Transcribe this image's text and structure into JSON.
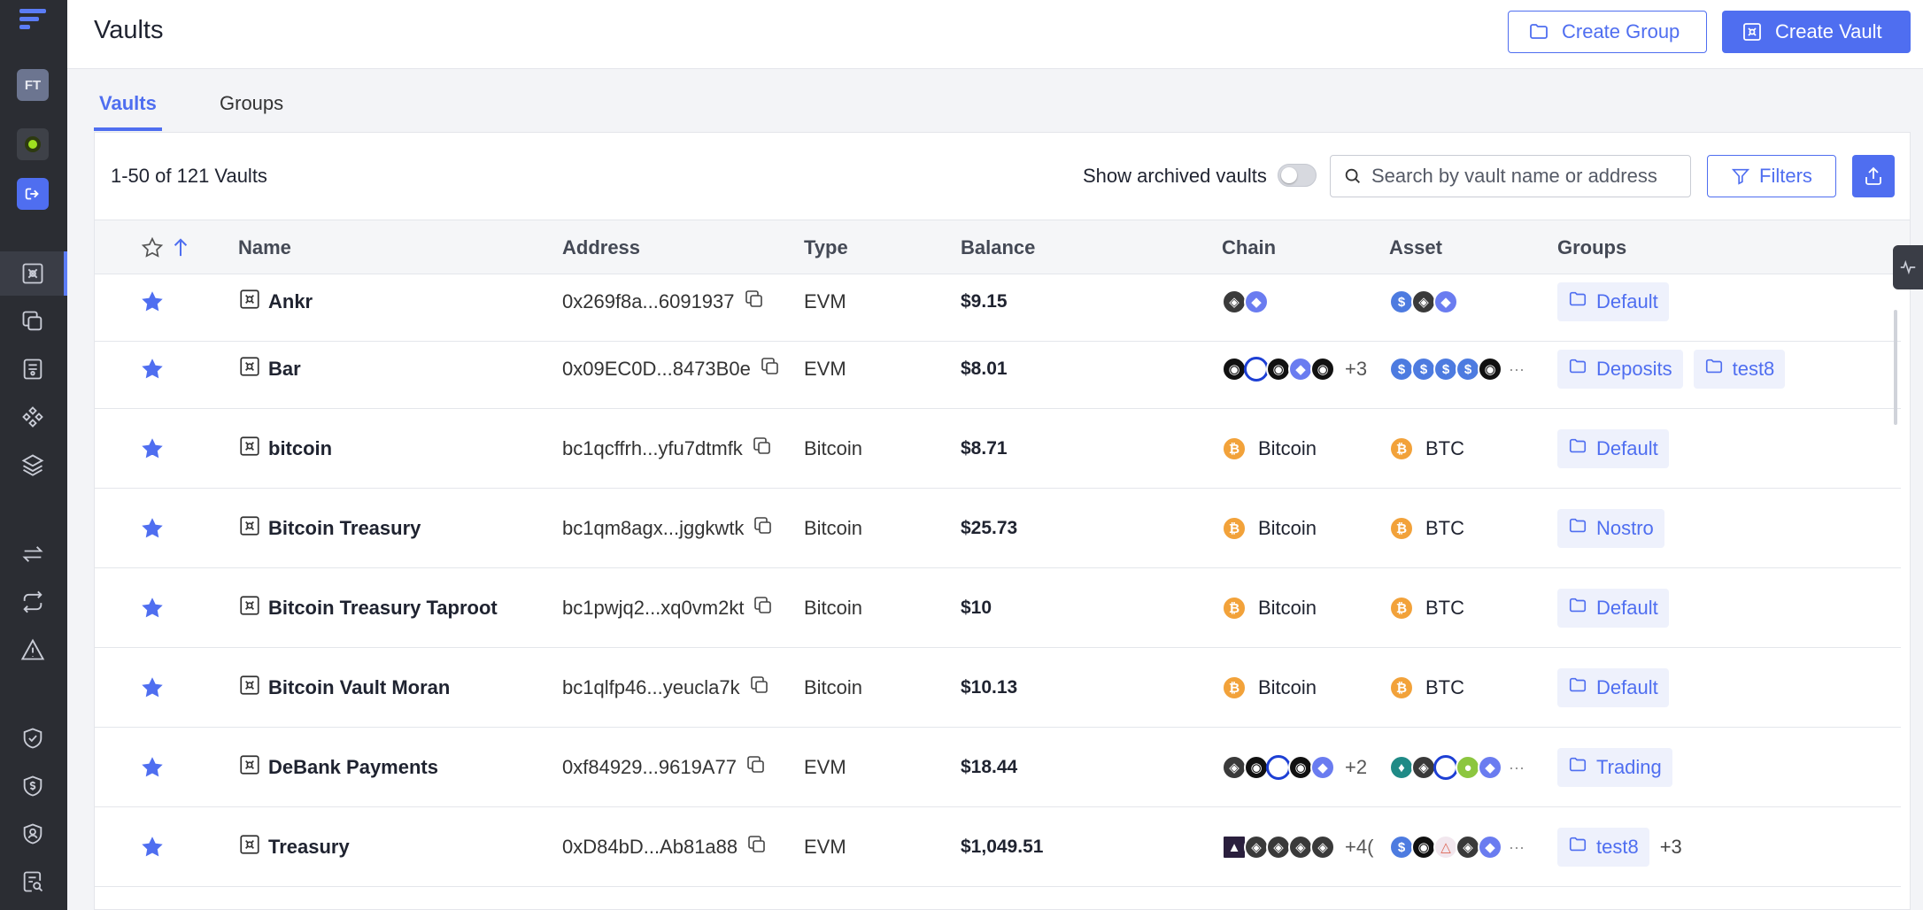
{
  "header": {
    "title": "Vaults",
    "create_group_label": "Create Group",
    "create_vault_label": "Create Vault"
  },
  "sidebar": {
    "avatar_initials": "FT"
  },
  "tabs": [
    {
      "label": "Vaults",
      "active": true
    },
    {
      "label": "Groups",
      "active": false
    }
  ],
  "toolbar": {
    "count_text": "1-50 of 121 Vaults",
    "show_archived_label": "Show archived vaults",
    "search_placeholder": "Search by vault name or address",
    "filters_label": "Filters"
  },
  "table": {
    "columns": [
      "Name",
      "Address",
      "Type",
      "Balance",
      "Chain",
      "Asset",
      "Groups"
    ],
    "rows": [
      {
        "name": "Ankr",
        "address": "0x269f8a...6091937",
        "type": "EVM",
        "balance": "$9.15",
        "chain_icons": [
          "coin-dark",
          "coin-eth"
        ],
        "chain_label": "",
        "chain_more": "",
        "asset_icons": [
          "coin-blue",
          "coin-dark",
          "coin-eth"
        ],
        "asset_label": "",
        "asset_more": false,
        "groups": [
          "Default"
        ],
        "groups_more": ""
      },
      {
        "name": "Bar",
        "address": "0x09EC0D...8473B0e",
        "type": "EVM",
        "balance": "$8.01",
        "chain_icons": [
          "coin-black",
          "coin-ring",
          "coin-black",
          "coin-eth",
          "coin-black"
        ],
        "chain_label": "",
        "chain_more": "+3",
        "asset_icons": [
          "coin-blue",
          "coin-blue",
          "coin-blue",
          "coin-blue",
          "coin-black"
        ],
        "asset_label": "",
        "asset_more": true,
        "groups": [
          "Deposits",
          "test8"
        ],
        "groups_more": ""
      },
      {
        "name": "bitcoin",
        "address": "bc1qcffrh...yfu7dtmfk",
        "type": "Bitcoin",
        "balance": "$8.71",
        "chain_icons": [
          "coin-btc"
        ],
        "chain_label": "Bitcoin",
        "chain_more": "",
        "asset_icons": [
          "coin-btc"
        ],
        "asset_label": "BTC",
        "asset_more": false,
        "groups": [
          "Default"
        ],
        "groups_more": ""
      },
      {
        "name": "Bitcoin Treasury",
        "address": "bc1qm8agx...jggkwtk",
        "type": "Bitcoin",
        "balance": "$25.73",
        "chain_icons": [
          "coin-btc"
        ],
        "chain_label": "Bitcoin",
        "chain_more": "",
        "asset_icons": [
          "coin-btc"
        ],
        "asset_label": "BTC",
        "asset_more": false,
        "groups": [
          "Nostro"
        ],
        "groups_more": ""
      },
      {
        "name": "Bitcoin Treasury Taproot",
        "address": "bc1pwjq2...xq0vm2kt",
        "type": "Bitcoin",
        "balance": "$10",
        "chain_icons": [
          "coin-btc"
        ],
        "chain_label": "Bitcoin",
        "chain_more": "",
        "asset_icons": [
          "coin-btc"
        ],
        "asset_label": "BTC",
        "asset_more": false,
        "groups": [
          "Default"
        ],
        "groups_more": ""
      },
      {
        "name": "Bitcoin Vault Moran",
        "address": "bc1qlfp46...yeucla7k",
        "type": "Bitcoin",
        "balance": "$10.13",
        "chain_icons": [
          "coin-btc"
        ],
        "chain_label": "Bitcoin",
        "chain_more": "",
        "asset_icons": [
          "coin-btc"
        ],
        "asset_label": "BTC",
        "asset_more": false,
        "groups": [
          "Default"
        ],
        "groups_more": ""
      },
      {
        "name": "DeBank Payments",
        "address": "0xf84929...9619A77",
        "type": "EVM",
        "balance": "$18.44",
        "chain_icons": [
          "coin-dark",
          "coin-black",
          "coin-ring",
          "coin-black",
          "coin-eth"
        ],
        "chain_label": "",
        "chain_more": "+2",
        "asset_icons": [
          "coin-teal",
          "coin-dark",
          "coin-ring",
          "coin-green",
          "coin-eth"
        ],
        "asset_label": "",
        "asset_more": true,
        "groups": [
          "Trading"
        ],
        "groups_more": ""
      },
      {
        "name": "Treasury",
        "address": "0xD84bD...Ab81a88",
        "type": "EVM",
        "balance": "$1,049.51",
        "chain_icons": [
          "coin-sq",
          "coin-dark",
          "coin-dark",
          "coin-dark",
          "coin-dark"
        ],
        "chain_label": "",
        "chain_more": "+4(",
        "asset_icons": [
          "coin-blue",
          "coin-black",
          "coin-pink",
          "coin-dark",
          "coin-eth"
        ],
        "asset_label": "",
        "asset_more": true,
        "groups": [
          "test8"
        ],
        "groups_more": "+3"
      }
    ]
  },
  "colors": {
    "accent": "#4f6ef0",
    "sidebar_bg": "#2b2d33",
    "star": "#4f6ef0"
  }
}
